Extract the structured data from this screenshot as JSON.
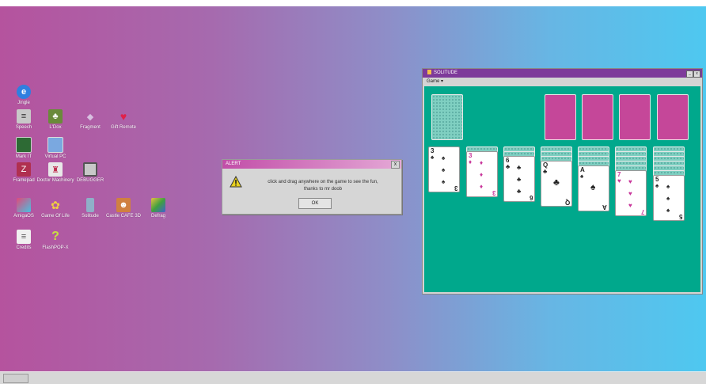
{
  "desktop": {
    "icons": [
      {
        "label": "Jingle",
        "icon": "e-logo-icon"
      },
      {
        "label": "Speech",
        "icon": "disk-icon"
      },
      {
        "label": "L'Dox",
        "icon": "tree-icon"
      },
      {
        "label": "Fragment",
        "icon": "paper-icon"
      },
      {
        "label": "Gift Remote",
        "icon": "gem-icon"
      },
      {
        "label": "Mark IT",
        "icon": "monitor-icon"
      },
      {
        "label": "Virtual PC",
        "icon": "window-icon"
      },
      {
        "label": "Framepad",
        "icon": "calendar-icon"
      },
      {
        "label": "Doctor Machinery",
        "icon": "robot-icon"
      },
      {
        "label": "DEBUGGER",
        "icon": "screen-icon"
      },
      {
        "label": "AmigaOS",
        "icon": "cube-icon"
      },
      {
        "label": "Game Of Life",
        "icon": "cells-icon"
      },
      {
        "label": "Solitude",
        "icon": "bottle-icon"
      },
      {
        "label": "Castle CAFE 3D",
        "icon": "face-icon"
      },
      {
        "label": "Defrag",
        "icon": "defrag-icon"
      },
      {
        "label": "Credits",
        "icon": "document-icon"
      },
      {
        "label": "FlashPOP-X",
        "icon": "question-icon"
      }
    ]
  },
  "dialog": {
    "title": "ALERT",
    "message_line1": "click and drag anywhere on the game to see the fun,",
    "message_line2": "thanks to mr doob",
    "ok_label": "OK",
    "close_label": "x"
  },
  "solitaire": {
    "title": "SOLITUDE",
    "menu_game": "Game ▾",
    "min_label": "_",
    "max_label": "x",
    "tableau": [
      {
        "rank": "3",
        "suit": "♠",
        "color": "black",
        "facedown": 0
      },
      {
        "rank": "3",
        "suit": "♦",
        "color": "red",
        "facedown": 1
      },
      {
        "rank": "6",
        "suit": "♣",
        "color": "black",
        "facedown": 2
      },
      {
        "rank": "Q",
        "suit": "♣",
        "color": "black",
        "facedown": 3
      },
      {
        "rank": "A",
        "suit": "♠",
        "color": "black",
        "facedown": 4
      },
      {
        "rank": "7",
        "suit": "♥",
        "color": "red",
        "facedown": 5
      },
      {
        "rank": "5",
        "suit": "♠",
        "color": "black",
        "facedown": 6
      }
    ]
  },
  "colors": {
    "felt": "#00a88c",
    "foundation": "#c54799",
    "red_suit": "#c8359a"
  }
}
